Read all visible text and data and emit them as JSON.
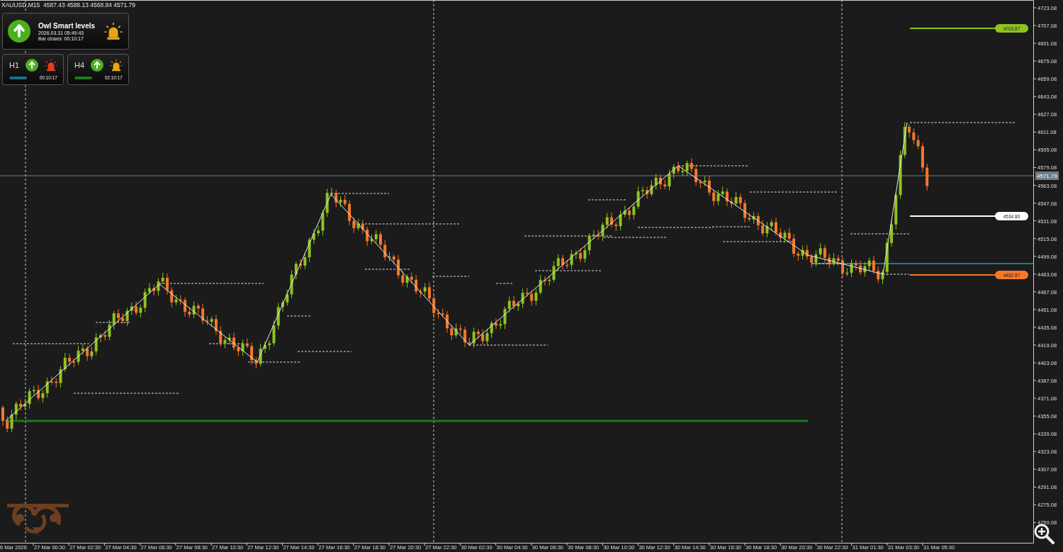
{
  "chart_header": "XAUUSD,M15  4587.43 4588.13 4568.84 4571.79",
  "main_panel": {
    "title": "Owl Smart levels",
    "datetime": "2026.03.31 05:49:43",
    "bar_closes": "Bar closes: 00:10:17",
    "kind": "up",
    "alarm": {
      "color": "#e8a317"
    }
  },
  "timeframes": [
    {
      "label": "H1",
      "kind": "up",
      "alarm": {
        "color": "#e0401a"
      },
      "color": "#1e6f80",
      "time": "00:10:17"
    },
    {
      "label": "H4",
      "kind": "up",
      "alarm": {
        "color": "#e8a317"
      },
      "color": "#1f7a1f",
      "time": "02:10:17"
    }
  ],
  "price_axis": [
    "4723.08",
    "4707.08",
    "4691.08",
    "4675.08",
    "4659.08",
    "4643.08",
    "4627.08",
    "4611.08",
    "4595.08",
    "4579.08",
    "4563.08",
    "4547.08",
    "4531.08",
    "4515.08",
    "4499.08",
    "4483.08",
    "4467.08",
    "4451.08",
    "4435.08",
    "4419.08",
    "4403.08",
    "4387.08",
    "4371.08",
    "4355.08",
    "4339.08",
    "4323.08",
    "4307.08",
    "4291.08",
    "4275.08",
    "4259.08"
  ],
  "time_axis": [
    "6 Mar 2026",
    "27 Mar 00:30",
    "27 Mar 02:30",
    "27 Mar 04:30",
    "27 Mar 06:30",
    "27 Mar 08:30",
    "27 Mar 10:30",
    "27 Mar 12:30",
    "27 Mar 14:30",
    "27 Mar 16:30",
    "27 Mar 18:30",
    "27 Mar 20:30",
    "27 Mar 22:30",
    "30 Mar 02:30",
    "30 Mar 04:30",
    "30 Mar 06:30",
    "30 Mar 08:30",
    "30 Mar 10:30",
    "30 Mar 12:30",
    "30 Mar 14:30",
    "30 Mar 16:30",
    "30 Mar 18:30",
    "30 Mar 20:30",
    "30 Mar 22:30",
    "31 Mar 01:30",
    "31 Mar 03:30",
    "31 Mar 05:30"
  ],
  "current_price": "4571.79",
  "level_tags": [
    {
      "value": "4703.87",
      "color": "#8fc31f"
    },
    {
      "value": "4534.80",
      "color": "#ffffff"
    },
    {
      "value": "4482.87",
      "color": "#f5782a"
    }
  ]
}
